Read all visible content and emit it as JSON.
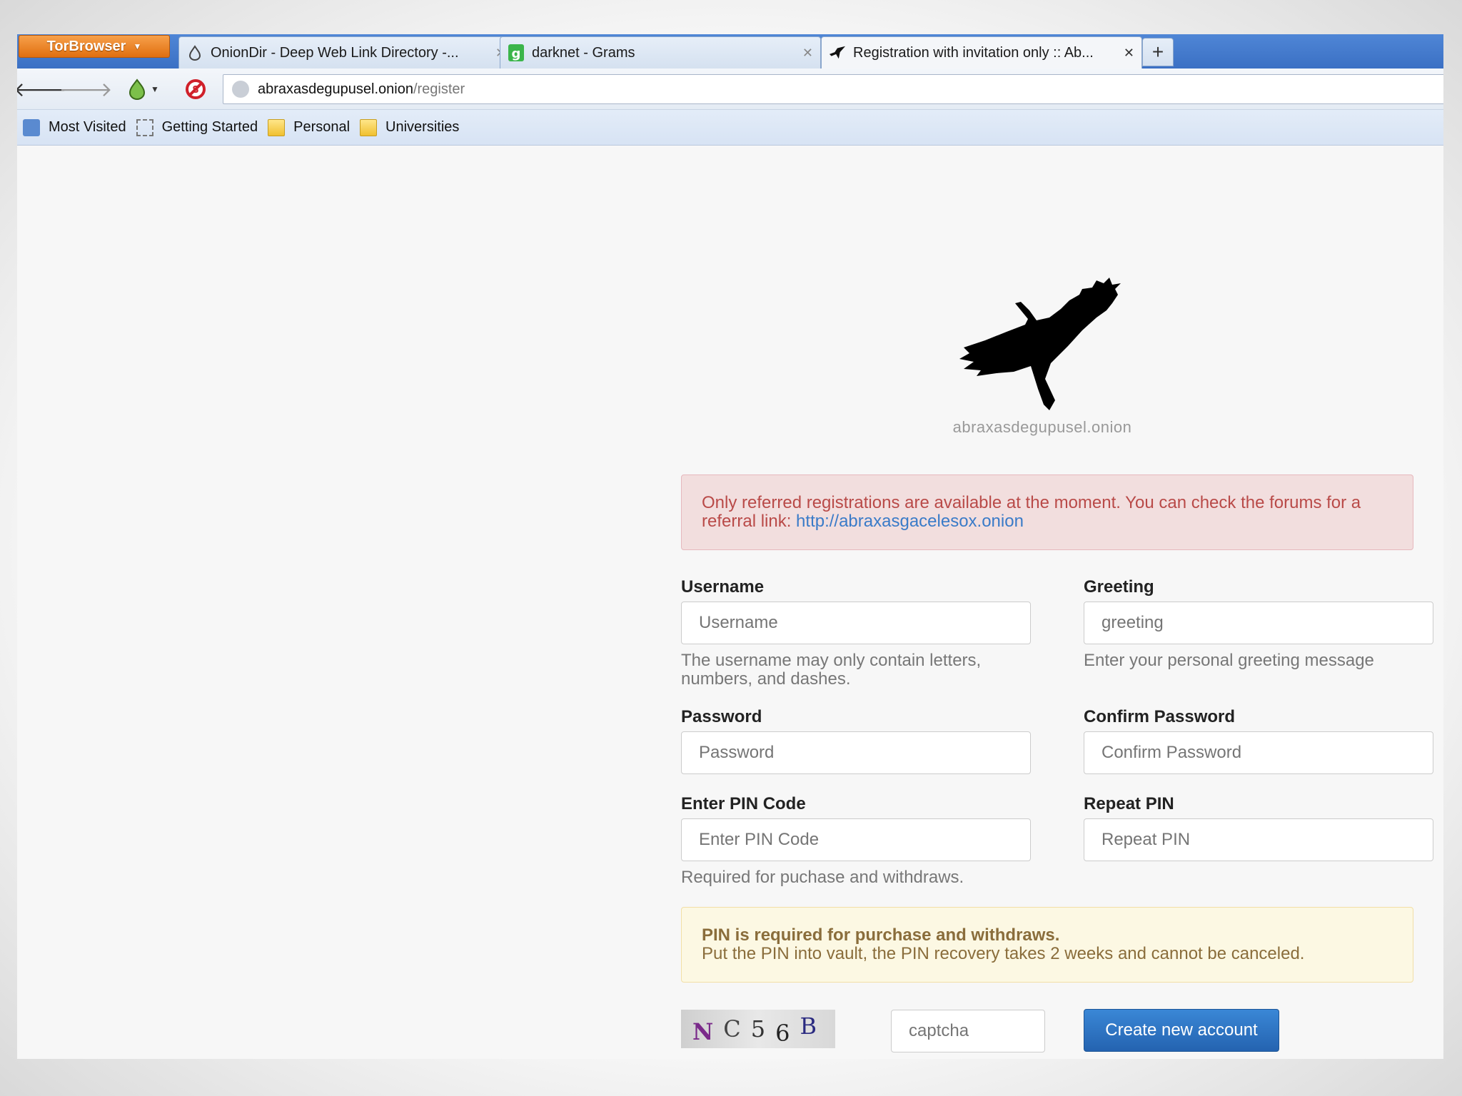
{
  "browser": {
    "menu_button": "TorBrowser",
    "tabs": [
      {
        "title": "OnionDir - Deep Web Link Directory -..."
      },
      {
        "title": "darknet - Grams"
      },
      {
        "title": "Registration with invitation only :: Ab..."
      }
    ],
    "new_tab": "+",
    "url": {
      "host": "abraxasdegupusel.onion",
      "path": "/register"
    },
    "bookmarks": [
      "Most Visited",
      "Getting Started",
      "Personal",
      "Universities"
    ]
  },
  "page": {
    "logo_text": "abraxasdegupusel.onion",
    "alert_text": "Only referred registrations are available at the moment. You can check the forums for a referral link: ",
    "alert_link": "http://abraxasgacelesox.onion",
    "username": {
      "label": "Username",
      "placeholder": "Username",
      "help": "The username may only contain letters, numbers, and dashes."
    },
    "greeting": {
      "label": "Greeting",
      "placeholder": "greeting",
      "help": "Enter your personal greeting message"
    },
    "password": {
      "label": "Password",
      "placeholder": "Password"
    },
    "confirm_password": {
      "label": "Confirm Password",
      "placeholder": "Confirm Password"
    },
    "pin": {
      "label": "Enter PIN Code",
      "placeholder": "Enter PIN Code",
      "help": "Required for puchase and withdraws."
    },
    "repeat_pin": {
      "label": "Repeat PIN",
      "placeholder": "Repeat PIN"
    },
    "warning_title": "PIN is required for purchase and withdraws.",
    "warning_text": "Put the PIN into vault, the PIN recovery takes 2 weeks and cannot be canceled.",
    "captcha_chars": [
      "N",
      "C",
      "5",
      "6",
      "B"
    ],
    "captcha_placeholder": "captcha",
    "submit_label": "Create new account"
  }
}
